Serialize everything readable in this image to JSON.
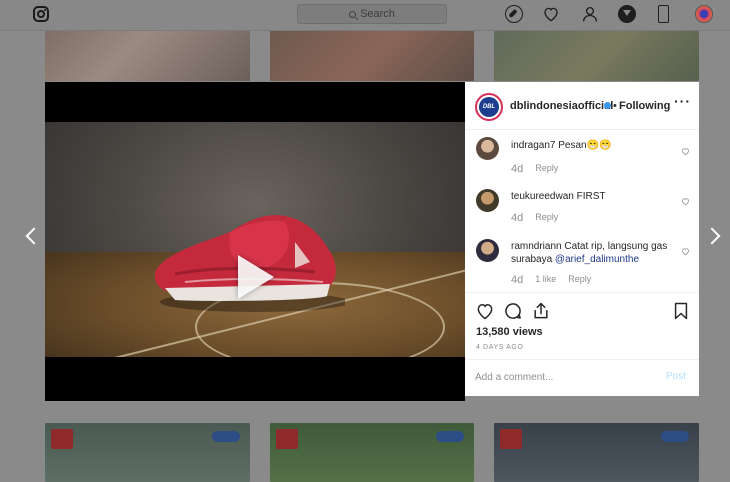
{
  "topbar": {
    "search_placeholder": "Search"
  },
  "post": {
    "owner": {
      "username": "dblindonesiaofficial",
      "avatar_text": "DBL",
      "follow_status": "Following",
      "separator": "•"
    },
    "comments": [
      {
        "username": "indragan7",
        "text": "Pesan😁😁",
        "time": "4d",
        "reply_label": "Reply",
        "likes_label": ""
      },
      {
        "username": "teukureedwan",
        "text": "FIRST",
        "time": "4d",
        "reply_label": "Reply",
        "likes_label": ""
      },
      {
        "username": "ramndriann",
        "text": "Catat rip, langsung gas surabaya ",
        "mention": "@arief_dalimunthe",
        "time": "4d",
        "reply_label": "Reply",
        "likes_label": "1 like"
      }
    ],
    "views": "13,580 views",
    "age": "4 DAYS AGO",
    "comment_placeholder": "Add a comment...",
    "post_label": "Post"
  },
  "colors": {
    "accent_blue": "#3897f0",
    "post_disabled": "#b2dffc",
    "story_ring": "#d62f5a",
    "dimmed_bg": "#8a8a8a"
  },
  "icons": {
    "top_nav": [
      "instagram-logo-icon",
      "compass-icon",
      "heart-icon",
      "profile-icon",
      "download-icon",
      "phone-icon",
      "avatar-icon"
    ],
    "actions": [
      "heart-icon",
      "comment-icon",
      "share-icon",
      "bookmark-icon"
    ],
    "nav": [
      "chevron-left-icon",
      "chevron-right-icon"
    ]
  }
}
